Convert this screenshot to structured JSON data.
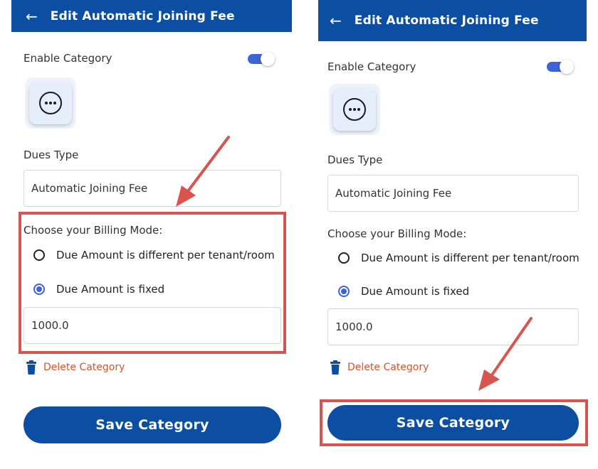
{
  "screens": [
    {
      "header": {
        "back_icon": "arrow-left-icon",
        "title": "Edit Automatic Joining Fee"
      },
      "enable_category": {
        "label": "Enable Category",
        "enabled": true
      },
      "category_icon": "more-horizontal-icon",
      "dues_type": {
        "label": "Dues Type",
        "value": "Automatic Joining Fee"
      },
      "billing_mode": {
        "label": "Choose your Billing Mode:",
        "options": [
          {
            "label": "Due Amount is different per tenant/room",
            "selected": false
          },
          {
            "label": "Due Amount is fixed",
            "selected": true
          }
        ],
        "amount": "1000.0"
      },
      "delete_label": "Delete Category",
      "save_label": "Save Category",
      "highlight": "billing-mode-section"
    },
    {
      "header": {
        "back_icon": "arrow-left-icon",
        "title": "Edit Automatic Joining Fee"
      },
      "enable_category": {
        "label": "Enable Category",
        "enabled": true
      },
      "category_icon": "more-horizontal-icon",
      "dues_type": {
        "label": "Dues Type",
        "value": "Automatic Joining Fee"
      },
      "billing_mode": {
        "label": "Choose your Billing Mode:",
        "options": [
          {
            "label": "Due Amount is different per tenant/room",
            "selected": false
          },
          {
            "label": "Due Amount is fixed",
            "selected": true
          }
        ],
        "amount": "1000.0"
      },
      "delete_label": "Delete Category",
      "save_label": "Save Category",
      "highlight": "save-button"
    }
  ],
  "colors": {
    "primary": "#0b4ea2",
    "accent": "#3d63d8",
    "danger": "#d4562a",
    "annotation": "#d9534f"
  }
}
